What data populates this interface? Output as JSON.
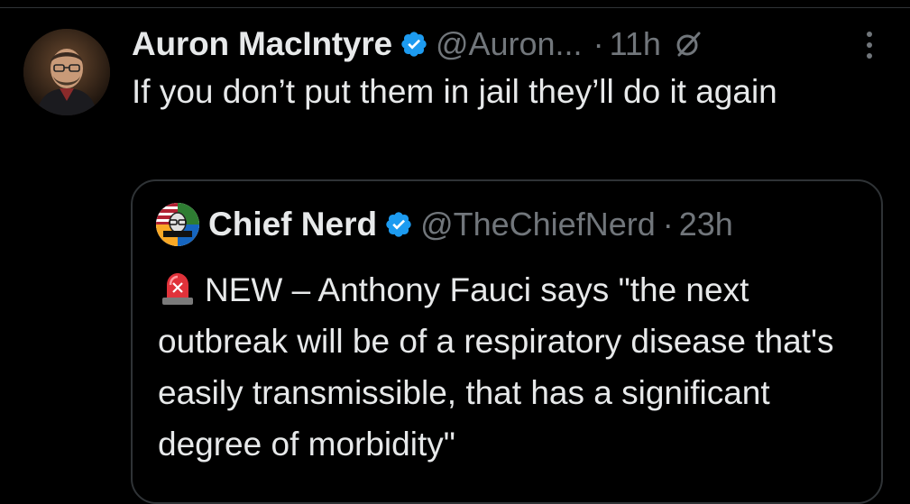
{
  "tweet": {
    "author_name": "Auron MacIntyre",
    "author_handle": "@Auron...",
    "separator": "·",
    "timestamp": "11h",
    "text": "If you don’t put them in jail they’ll do it again",
    "avatar_icon": "person-avatar",
    "verified_icon": "verified-badge-icon",
    "grok_icon": "grok-icon",
    "more_icon": "more-options-icon"
  },
  "quote": {
    "author_name": "Chief Nerd",
    "author_handle": "@TheChiefNerd",
    "separator": "·",
    "timestamp": "23h",
    "emoji": "🚨",
    "text": "NEW – Anthony Fauci says \"the next outbreak will be of a respiratory disease that's easily transmissible, that has a significant degree of morbidity\"",
    "avatar_icon": "chief-nerd-logo",
    "verified_icon": "verified-badge-icon"
  },
  "colors": {
    "background": "#000000",
    "primary_text": "#e7e9ea",
    "secondary_text": "#71767b",
    "border": "#2f3336",
    "verified_blue": "#1d9bf0"
  }
}
